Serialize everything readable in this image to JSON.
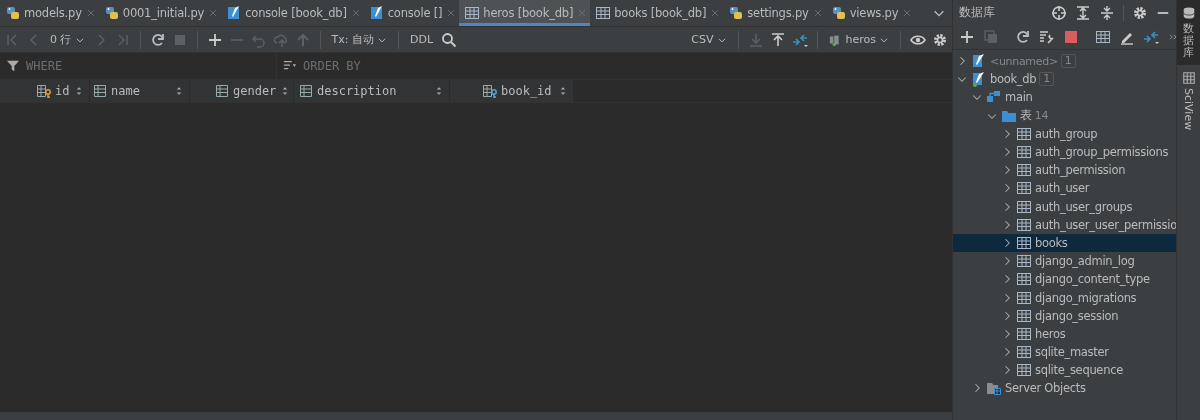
{
  "editor_tabs": [
    {
      "label": "models.py",
      "kind": "python",
      "selected": false
    },
    {
      "label": "0001_initial.py",
      "kind": "python",
      "selected": false
    },
    {
      "label": "console [book_db]",
      "kind": "console",
      "selected": false
    },
    {
      "label": "console []",
      "kind": "console",
      "selected": false
    },
    {
      "label": "heros [book_db]",
      "kind": "table",
      "selected": true
    },
    {
      "label": "books [book_db]",
      "kind": "table",
      "selected": false
    },
    {
      "label": "settings.py",
      "kind": "python",
      "selected": false
    },
    {
      "label": "views.py",
      "kind": "python",
      "selected": false
    }
  ],
  "toolbar": {
    "row_count": "0 行",
    "tx_mode": "Tx: 自动",
    "ddl": "DDL",
    "export_format": "CSV",
    "schema": "heros"
  },
  "filter": {
    "where_placeholder": "WHERE",
    "order_by_placeholder": "ORDER BY"
  },
  "columns": [
    {
      "name": "id",
      "kind": "key"
    },
    {
      "name": "name",
      "kind": "column"
    },
    {
      "name": "gender",
      "kind": "column"
    },
    {
      "name": "description",
      "kind": "column"
    },
    {
      "name": "book_id",
      "kind": "foreign_key"
    }
  ],
  "database_panel": {
    "title": "数据库",
    "tree": [
      {
        "label": "<unnamed>",
        "count": "1",
        "kind": "datasource",
        "connected": false,
        "expanded": false,
        "selected": false
      },
      {
        "label": "book_db",
        "count": "1",
        "kind": "datasource",
        "connected": true,
        "expanded": true,
        "selected": false,
        "children": [
          {
            "label": "main",
            "kind": "schema",
            "expanded": true,
            "selected": false,
            "children": [
              {
                "label": "表",
                "count": "14",
                "kind": "folder",
                "expanded": true,
                "selected": false,
                "children": [
                  {
                    "label": "auth_group",
                    "kind": "table",
                    "expanded": false,
                    "selected": false
                  },
                  {
                    "label": "auth_group_permissions",
                    "kind": "table",
                    "expanded": false,
                    "selected": false
                  },
                  {
                    "label": "auth_permission",
                    "kind": "table",
                    "expanded": false,
                    "selected": false
                  },
                  {
                    "label": "auth_user",
                    "kind": "table",
                    "expanded": false,
                    "selected": false
                  },
                  {
                    "label": "auth_user_groups",
                    "kind": "table",
                    "expanded": false,
                    "selected": false
                  },
                  {
                    "label": "auth_user_user_permissio",
                    "kind": "table",
                    "expanded": false,
                    "selected": false
                  },
                  {
                    "label": "books",
                    "kind": "table",
                    "expanded": false,
                    "selected": true
                  },
                  {
                    "label": "django_admin_log",
                    "kind": "table",
                    "expanded": false,
                    "selected": false
                  },
                  {
                    "label": "django_content_type",
                    "kind": "table",
                    "expanded": false,
                    "selected": false
                  },
                  {
                    "label": "django_migrations",
                    "kind": "table",
                    "expanded": false,
                    "selected": false
                  },
                  {
                    "label": "django_session",
                    "kind": "table",
                    "expanded": false,
                    "selected": false
                  },
                  {
                    "label": "heros",
                    "kind": "table",
                    "expanded": false,
                    "selected": false
                  },
                  {
                    "label": "sqlite_master",
                    "kind": "table",
                    "expanded": false,
                    "selected": false
                  },
                  {
                    "label": "sqlite_sequence",
                    "kind": "table",
                    "expanded": false,
                    "selected": false
                  }
                ]
              }
            ]
          },
          {
            "label": "Server Objects",
            "kind": "server",
            "expanded": false,
            "selected": false
          }
        ]
      }
    ]
  },
  "side_strip": [
    {
      "label": "数据库",
      "selected": true
    },
    {
      "label": "SciView",
      "selected": false
    }
  ]
}
